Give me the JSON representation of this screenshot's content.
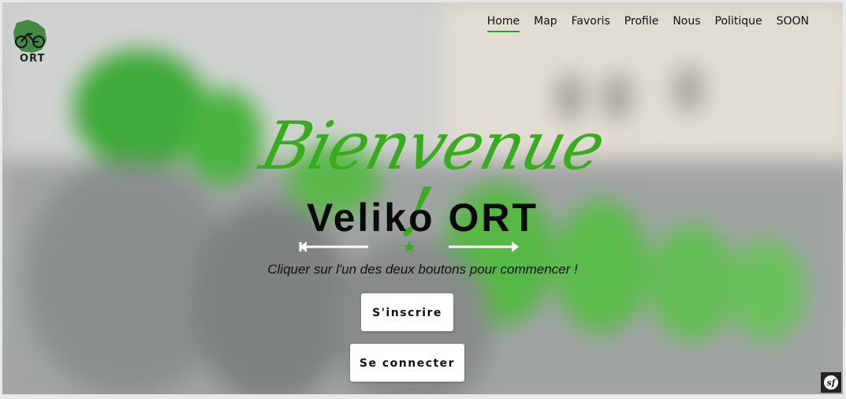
{
  "nav": {
    "items": [
      {
        "label": "Home",
        "active": true
      },
      {
        "label": "Map",
        "active": false
      },
      {
        "label": "Favoris",
        "active": false
      },
      {
        "label": "Profile",
        "active": false
      },
      {
        "label": "Nous",
        "active": false
      },
      {
        "label": "Politique",
        "active": false
      },
      {
        "label": "SOON",
        "active": false
      }
    ]
  },
  "logo": {
    "text": "ORT",
    "icon": "bicycle-map-icon"
  },
  "hero": {
    "script_title": "Bienvenue !",
    "title": "Veliko ORT",
    "subtitle": "Cliquer sur l'un des deux boutons pour commencer !",
    "divider_icon": "star-icon"
  },
  "buttons": {
    "signup": "S'inscrire",
    "login": "Se connecter"
  },
  "debug_badge": {
    "text": "sf",
    "icon": "symfony-icon"
  },
  "colors": {
    "accent_green": "#3aab1e",
    "nav_underline": "#2e9e2e",
    "text_dark": "#0a0a0a",
    "button_bg": "#ffffff"
  }
}
